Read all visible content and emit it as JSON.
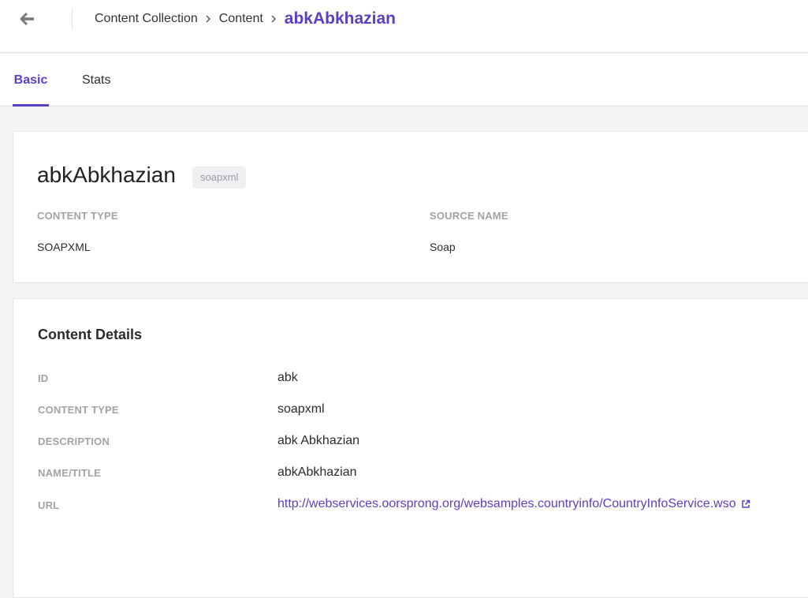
{
  "header": {
    "breadcrumb": [
      "Content Collection",
      "Content"
    ],
    "current": "abkAbkhazian"
  },
  "tabs": [
    "Basic",
    "Stats"
  ],
  "summary": {
    "title": "abkAbkhazian",
    "badge": "soapxml",
    "content_type_label": "CONTENT TYPE",
    "content_type_value": "SOAPXML",
    "source_name_label": "SOURCE NAME",
    "source_name_value": "Soap"
  },
  "details": {
    "heading": "Content Details",
    "rows": [
      {
        "label": "ID",
        "value": "abk"
      },
      {
        "label": "CONTENT TYPE",
        "value": "soapxml"
      },
      {
        "label": "DESCRIPTION",
        "value": "abk Abkhazian"
      },
      {
        "label": "NAME/TITLE",
        "value": "abkAbkhazian"
      },
      {
        "label": "URL",
        "value": "http://webservices.oorsprong.org/websamples.countryinfo/CountryInfoService.wso"
      }
    ]
  },
  "colors": {
    "accent": "#5b3fc4",
    "label": "#a2a2a8",
    "background": "#f4f4f6"
  },
  "icons": {
    "back": "arrow-left-icon",
    "separator": "chevron-right-icon",
    "external": "external-link-icon"
  }
}
